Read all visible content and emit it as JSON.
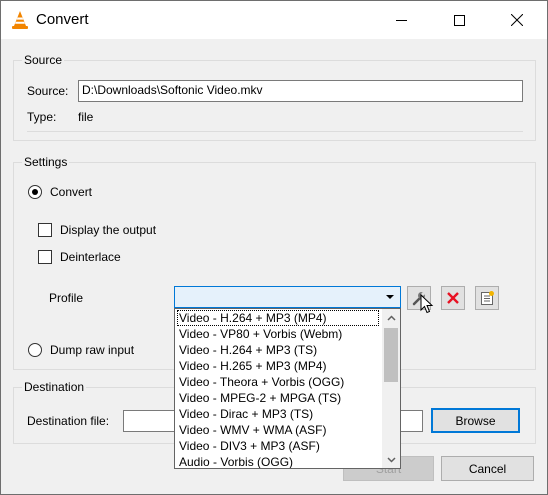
{
  "window": {
    "title": "Convert"
  },
  "source": {
    "group_title": "Source",
    "source_label": "Source:",
    "source_value": "D:\\Downloads\\Softonic Video.mkv",
    "type_label": "Type:",
    "type_value": "file"
  },
  "settings": {
    "group_title": "Settings",
    "convert_label": "Convert",
    "display_output_label": "Display the output",
    "deinterlace_label": "Deinterlace",
    "profile_label": "Profile",
    "dump_raw_label": "Dump raw input",
    "profile_options": [
      "Video - H.264 + MP3 (MP4)",
      "Video - VP80 + Vorbis (Webm)",
      "Video - H.264 + MP3 (TS)",
      "Video - H.265 + MP3 (MP4)",
      "Video - Theora + Vorbis (OGG)",
      "Video - MPEG-2 + MPGA (TS)",
      "Video - Dirac + MP3 (TS)",
      "Video - WMV + WMA (ASF)",
      "Video - DIV3 + MP3 (ASF)",
      "Audio - Vorbis (OGG)"
    ]
  },
  "destination": {
    "group_title": "Destination",
    "dest_label": "Destination file:",
    "browse_label": "Browse"
  },
  "footer": {
    "start_label": "Start",
    "cancel_label": "Cancel"
  },
  "icons": {
    "app": "vlc-cone-icon",
    "edit_profile": "wrench-icon",
    "delete_profile": "red-x-icon",
    "new_profile": "new-profile-icon"
  },
  "colors": {
    "accent": "#0078d7",
    "delete": "#e81123",
    "vlc_orange": "#f28500"
  }
}
